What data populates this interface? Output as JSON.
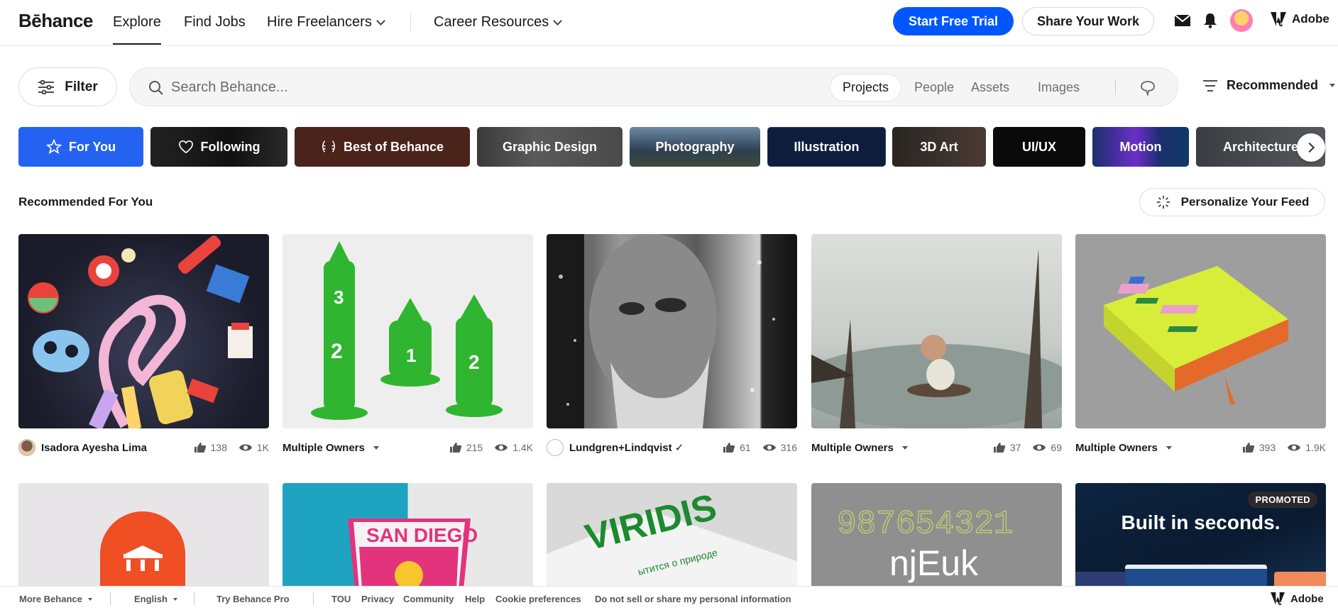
{
  "header": {
    "logo": "Bēhance",
    "nav": {
      "explore": "Explore",
      "find_jobs": "Find Jobs",
      "hire_freelancers": "Hire Freelancers",
      "career_resources": "Career Resources"
    },
    "start_trial": "Start Free Trial",
    "share_work": "Share Your Work",
    "adobe": "Adobe",
    "icons": [
      "mail-icon",
      "bell-icon",
      "user-avatar",
      "adobe-logo-icon"
    ]
  },
  "search": {
    "filter_label": "Filter",
    "placeholder": "Search Behance...",
    "scopes": [
      "Projects",
      "People",
      "Assets",
      "Images"
    ],
    "active_scope": "Projects",
    "sort_label": "Recommended"
  },
  "categories": [
    {
      "label": "For You",
      "color": "#1f5cf0"
    },
    {
      "label": "Following",
      "color": "#111111"
    },
    {
      "label": "Best of Behance",
      "color": "#4a241c"
    },
    {
      "label": "Graphic Design",
      "color": "#4a4a4a"
    },
    {
      "label": "Photography",
      "color": "#3c4a5a"
    },
    {
      "label": "Illustration",
      "color": "#0f1e3a"
    },
    {
      "label": "3D Art",
      "color": "#3a2f2a"
    },
    {
      "label": "UI/UX",
      "color": "#0b0b0b"
    },
    {
      "label": "Motion",
      "color": "#22346e"
    },
    {
      "label": "Architecture",
      "color": "#3a3d42"
    }
  ],
  "section": {
    "title": "Recommended For You",
    "personalize": "Personalize Your Feed"
  },
  "projects": [
    {
      "owner": "Isadora Ayesha Lima",
      "likes": "138",
      "views": "1K",
      "multiple": false
    },
    {
      "owner": "Multiple Owners",
      "likes": "215",
      "views": "1.4K",
      "multiple": true
    },
    {
      "owner": "Lundgren+Lindqvist ✓",
      "likes": "61",
      "views": "316",
      "multiple": false
    },
    {
      "owner": "Multiple Owners",
      "likes": "37",
      "views": "69",
      "multiple": true
    },
    {
      "owner": "Multiple Owners",
      "likes": "393",
      "views": "1.9K",
      "multiple": true
    }
  ],
  "row2": {
    "san_diego": "SAN DIEGO",
    "viridis": "VIRIDIS",
    "viridis_sub": "ытится о природе",
    "numbers": "987654321",
    "letters": "njEuk",
    "promoted_badge": "PROMOTED",
    "ad_headline": "Built in seconds."
  },
  "footer": {
    "more_behance": "More Behance",
    "language": "English",
    "try_pro": "Try Behance Pro",
    "links": [
      "TOU",
      "Privacy",
      "Community",
      "Help",
      "Cookie preferences",
      "Do not sell or share my personal information"
    ],
    "adobe": "Adobe"
  }
}
